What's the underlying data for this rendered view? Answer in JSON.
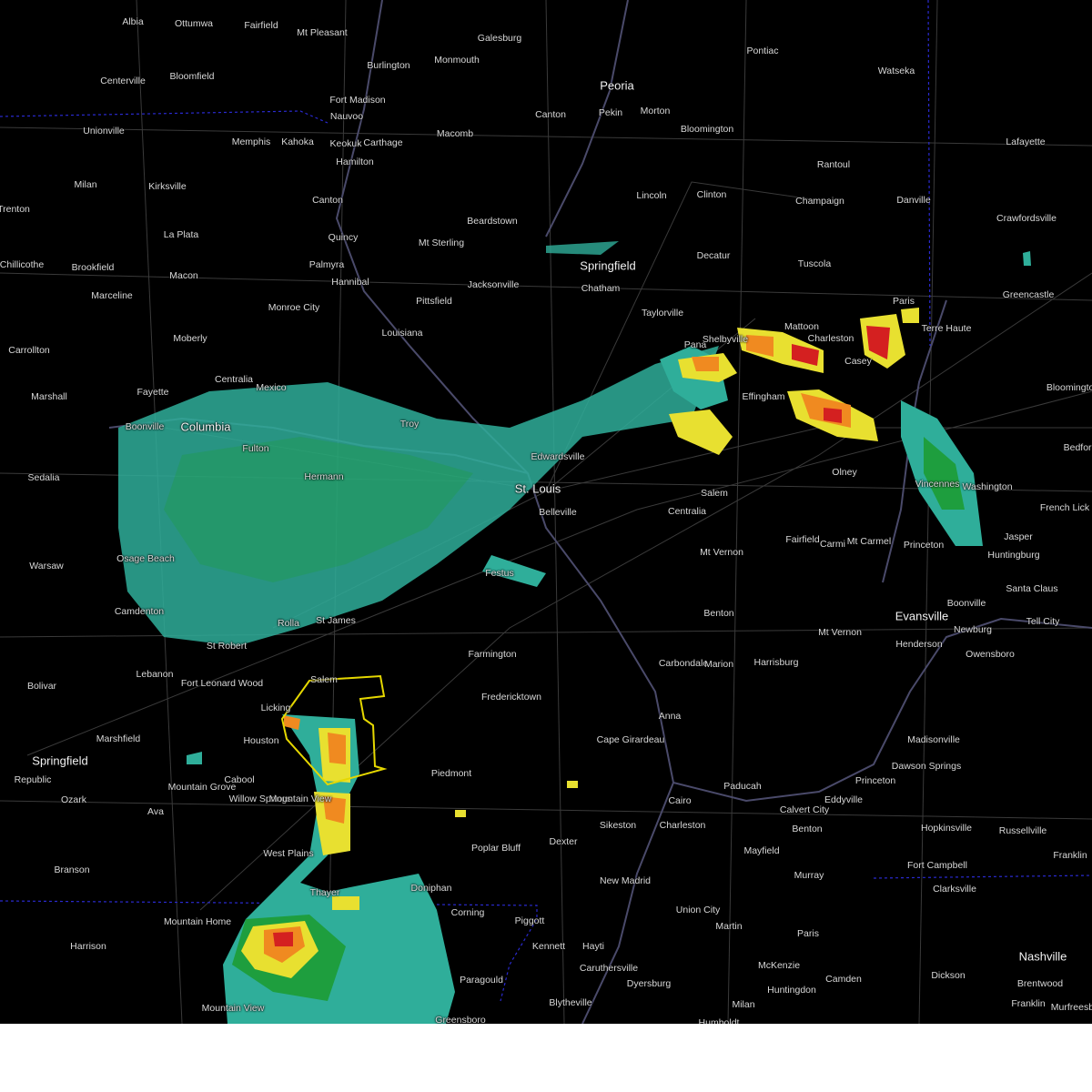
{
  "colors": {
    "background": "#000000",
    "border_state": "#2a2ad0",
    "road": "#3a3a3a",
    "river": "#4a4a6a",
    "warning_polygon": "#e6d800",
    "radar_light": "#2fae9a",
    "radar_green": "#1e9e3e",
    "radar_yellow": "#e8e030",
    "radar_orange": "#f08a20",
    "radar_red": "#d42020",
    "footer": "#ffffff"
  },
  "cities": [
    "Albia",
    "Ottumwa",
    "Fairfield",
    "Mt Pleasant",
    "Galesburg",
    "Pontiac",
    "Watseka",
    "Centerville",
    "Bloomfield",
    "Burlington",
    "Monmouth",
    "Peoria",
    "Fort Madison",
    "Nauvoo",
    "Pekin",
    "Morton",
    "Canton",
    "Unionville",
    "Memphis",
    "Kahoka",
    "Keokuk",
    "Carthage",
    "Macomb",
    "Bloomington",
    "Lafayette",
    "Hamilton",
    "Rantoul",
    "Milan",
    "Kirksville",
    "Lincoln",
    "Clinton",
    "Champaign",
    "Danville",
    "Trenton",
    "Canton",
    "Beardstown",
    "Crawfordsville",
    "La Plata",
    "Quincy",
    "Mt Sterling",
    "Chillicothe",
    "Brookfield",
    "Palmyra",
    "Springfield",
    "Decatur",
    "Tuscola",
    "Macon",
    "Hannibal",
    "Jacksonville",
    "Marceline",
    "Pittsfield",
    "Chatham",
    "Greencastle",
    "Monroe City",
    "Taylorville",
    "Paris",
    "Moberly",
    "Louisiana",
    "Pana",
    "Shelbyville",
    "Mattoon",
    "Charleston",
    "Terre Haute",
    "Carrollton",
    "Casey",
    "Centralia",
    "Mexico",
    "Marshall",
    "Fayette",
    "Effingham",
    "Bloomington",
    "Boonville",
    "Columbia",
    "Troy",
    "Edwardsville",
    "Bedford",
    "Sedalia",
    "Fulton",
    "Hermann",
    "St. Louis",
    "Salem",
    "Olney",
    "Vincennes",
    "Washington",
    "Belleville",
    "Centralia",
    "French Lick",
    "Warsaw",
    "Fairfield",
    "Mt Carmel",
    "Princeton",
    "Jasper",
    "Osage Beach",
    "Festus",
    "Mt Vernon",
    "Huntingburg",
    "Camdenton",
    "Carmi",
    "Boonville",
    "Santa Claus",
    "Rolla",
    "St James",
    "Benton",
    "Evansville",
    "Mt Vernon",
    "Newburg",
    "Tell City",
    "St Robert",
    "Farmington",
    "Henderson",
    "Owensboro",
    "Lebanon",
    "Fort Leonard Wood",
    "Salem",
    "Carbondale",
    "Marion",
    "Harrisburg",
    "Bolivar",
    "Licking",
    "Fredericktown",
    "Anna",
    "Marshfield",
    "Houston",
    "Cape Girardeau",
    "Madisonville",
    "Springfield",
    "Piedmont",
    "Dawson Springs",
    "Republic",
    "Mountain Grove",
    "Cabool",
    "Paducah",
    "Princeton",
    "Willow Springs",
    "Mountain View",
    "Cairo",
    "Calvert City",
    "Eddyville",
    "Ozark",
    "Ava",
    "Sikeston",
    "Charleston",
    "Benton",
    "Hopkinsville",
    "Russellville",
    "Poplar Bluff",
    "Dexter",
    "Mayfield",
    "West Plains",
    "Fort Campbell",
    "Franklin",
    "Branson",
    "New Madrid",
    "Murray",
    "Clarksville",
    "Thayer",
    "Doniphan",
    "Corning",
    "Union City",
    "Piggott",
    "Mountain Home",
    "Martin",
    "Paris",
    "Harrison",
    "Kennett",
    "Hayti",
    "Nashville",
    "Caruthersville",
    "McKenzie",
    "Camden",
    "Dickson",
    "Paragould",
    "Dyersburg",
    "Huntingdon",
    "Brentwood",
    "Milan",
    "Franklin",
    "Blytheville",
    "Mountain View",
    "Humboldt",
    "Murfreesboro",
    "Greensboro"
  ],
  "footer_text": ""
}
